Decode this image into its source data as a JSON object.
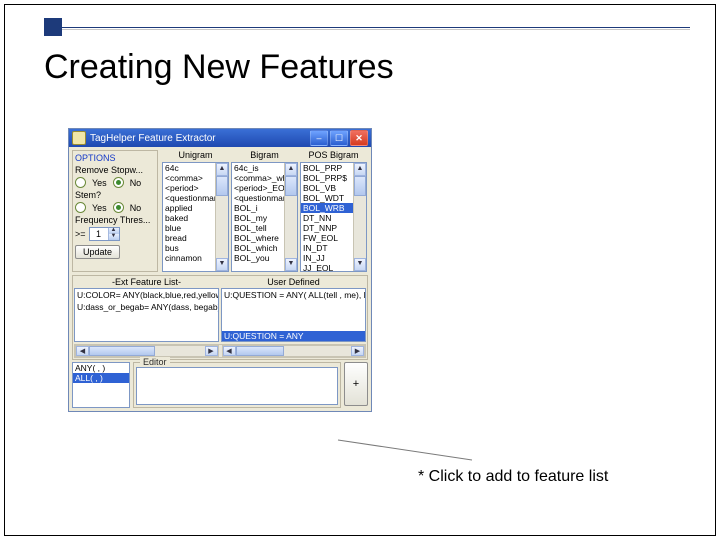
{
  "slide": {
    "title": "Creating New Features",
    "annotation": "* Click to add to feature list"
  },
  "window": {
    "title": "TagHelper Feature Extractor",
    "options": {
      "group": "OPTIONS",
      "remove_stopw_label": "Remove Stopw...",
      "stem_label": "Stem?",
      "freq_label": "Frequency Thres...",
      "yes": "Yes",
      "no": "No",
      "remove_stopw_sel": "No",
      "stem_sel": "No",
      "freq_op": ">=",
      "freq_val": "1",
      "update": "Update"
    },
    "lists": {
      "unigram": {
        "header": "Unigram",
        "items": [
          "64c",
          "<comma>",
          "<period>",
          "<questionmark>",
          "applied",
          "baked",
          "blue",
          "bread",
          "bus",
          "cinnamon"
        ]
      },
      "bigram": {
        "header": "Bigram",
        "items": [
          "64c_is",
          "<comma>_whic",
          "<period>_EOL",
          "<questionmark",
          "BOL_i",
          "BOL_my",
          "BOL_tell",
          "BOL_where",
          "BOL_which",
          "BOL_you"
        ]
      },
      "pos": {
        "header": "POS Bigram",
        "items": [
          "BOL_PRP",
          "BOL_PRP$",
          "BOL_VB",
          "BOL_WDT",
          "BOL_WRB",
          "DT_NN",
          "DT_NNP",
          "FW_EOL",
          "IN_DT",
          "IN_JJ",
          "JJ_EOL"
        ],
        "selected": 4
      }
    },
    "ext": {
      "title": "-Ext Feature List-",
      "lines": [
        "U:COLOR= ANY(black,blue,red,yellow,wh",
        "U:dass_or_begab= ANY(dass, begab)"
      ]
    },
    "userdef": {
      "title": "User Defined",
      "line": "U:QUESTION = ANY( ALL(tell , me), BOL",
      "selected_strip": "U:QUESTION = ANY"
    },
    "any_list": {
      "items": [
        "ANY( , )",
        "ALL( , )"
      ],
      "selected": 1
    },
    "editor_title": "Editor",
    "add_glyph": "+"
  }
}
